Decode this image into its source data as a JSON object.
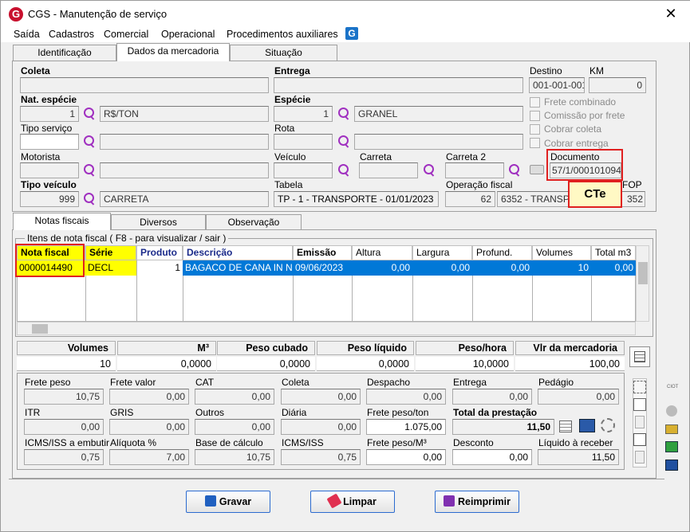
{
  "window": {
    "title": "CGS - Manutenção de serviço",
    "close": "✕"
  },
  "menu": [
    "Saída",
    "Cadastros",
    "Comercial",
    "Operacional",
    "Procedimentos auxiliares"
  ],
  "tabs": [
    "Identificação",
    "Dados da mercadoria",
    "Situação"
  ],
  "top": {
    "coleta_label": "Coleta",
    "entrega_label": "Entrega",
    "destino_label": "Destino",
    "destino_value": "001-001-001",
    "km_label": "KM",
    "km_value": "0",
    "nat_especie_label": "Nat. espécie",
    "nat_especie_code": "1",
    "nat_especie_desc": "R$/TON",
    "especie_label": "Espécie",
    "especie_code": "1",
    "especie_desc": "GRANEL",
    "tipo_servico_label": "Tipo serviço",
    "rota_label": "Rota",
    "motorista_label": "Motorista",
    "veiculo_label": "Veículo",
    "carreta_label": "Carreta",
    "carreta2_label": "Carreta 2",
    "documento_label": "Documento",
    "documento_value": "57/1/000101094",
    "tipo_veiculo_label": "Tipo veículo",
    "tipo_veiculo_code": "999",
    "tipo_veiculo_desc": "CARRETA",
    "tabela_label": "Tabela",
    "tabela_value": "TP - 1 - TRANSPORTE - 01/01/2023",
    "operacao_label": "Operação fiscal",
    "operacao_code": "62",
    "operacao_desc": "6352 - TRANSP.",
    "cfop_label": "FOP",
    "cfop_value": "352",
    "checks": [
      "Frete combinado",
      "Comissão por frete",
      "Cobrar coleta",
      "Cobrar entrega"
    ],
    "cte_callout": "CTe"
  },
  "subtabs": [
    "Notas fiscais",
    "Diversos",
    "Observação"
  ],
  "nf": {
    "group_label": "Itens de nota fiscal ( F8 - para visualizar / sair )",
    "columns": [
      "Nota fiscal",
      "Série",
      "Produto",
      "Descrição",
      "Emissão",
      "Altura",
      "Largura",
      "Profund.",
      "Volumes",
      "Total m3"
    ],
    "row": [
      "0000014490",
      "DECL",
      "1",
      "BAGACO DE CANA IN N...",
      "09/06/2023",
      "0,00",
      "0,00",
      "0,00",
      "10",
      "0,00"
    ]
  },
  "summary": {
    "headers": [
      "Volumes",
      "M³",
      "Peso cubado",
      "Peso líquido",
      "Peso/hora",
      "Vlr da mercadoria"
    ],
    "values": [
      "10",
      "0,0000",
      "0,0000",
      "0,0000",
      "10,0000",
      "100,00"
    ]
  },
  "valores": {
    "r1": [
      [
        "Frete peso",
        "10,75"
      ],
      [
        "Frete valor",
        "0,00"
      ],
      [
        "CAT",
        "0,00"
      ],
      [
        "Coleta",
        "0,00"
      ],
      [
        "Despacho",
        "0,00"
      ],
      [
        "Entrega",
        "0,00"
      ],
      [
        "Pedágio",
        "0,00"
      ]
    ],
    "r2": [
      [
        "ITR",
        "0,00"
      ],
      [
        "GRIS",
        "0,00"
      ],
      [
        "Outros",
        "0,00"
      ],
      [
        "Diária",
        "0,00"
      ],
      [
        "Frete peso/ton",
        "1.075,00"
      ],
      [
        "Total da prestação",
        "11,50"
      ]
    ],
    "r3": [
      [
        "ICMS/ISS a embutir",
        "0,75"
      ],
      [
        "Alíquota %",
        "7,00"
      ],
      [
        "Base de cálculo",
        "10,75"
      ],
      [
        "ICMS/ISS",
        "0,75"
      ],
      [
        "Frete peso/M³",
        "0,00"
      ],
      [
        "Desconto",
        "0,00"
      ],
      [
        "Líquido à receber",
        "11,50"
      ]
    ]
  },
  "buttons": {
    "gravar": "Gravar",
    "limpar": "Limpar",
    "reimprimir": "Reimprimir"
  },
  "colors": {
    "selection": "#0078d7",
    "highlight": "#ffff00",
    "callout_border": "#e02020"
  }
}
